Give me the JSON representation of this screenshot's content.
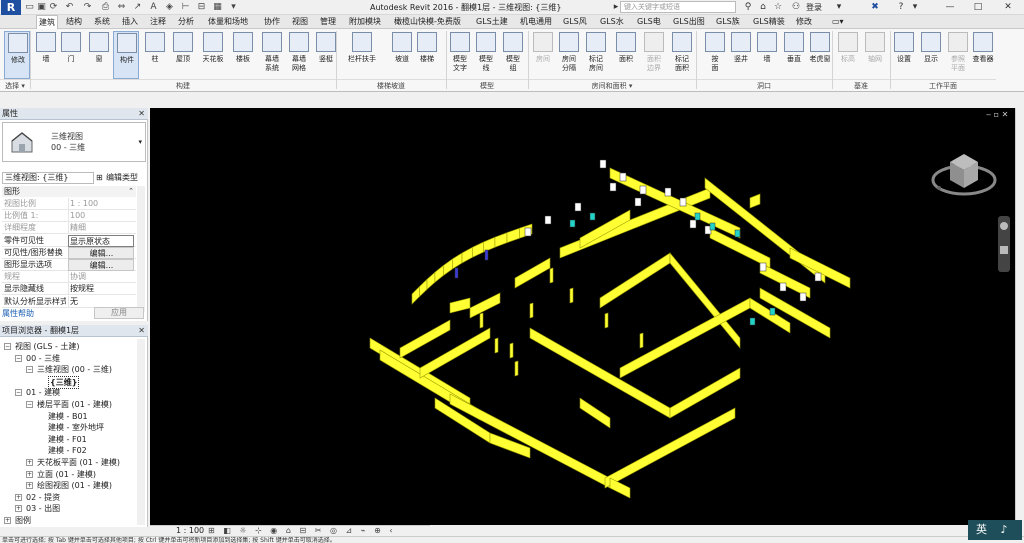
{
  "window": {
    "app_logo": "R",
    "title": "Autodesk Revit 2016 -    翻模1层 - 三维视图: {三维}",
    "search_placeholder": "键入关键字或短语",
    "login": "登录",
    "minimize": "—",
    "maximize": "□",
    "close": "✕"
  },
  "tabs": [
    "建筑",
    "结构",
    "系统",
    "插入",
    "注释",
    "分析",
    "体量和场地",
    "协作",
    "视图",
    "管理",
    "附加模块",
    "橄榄山快模-免费版",
    "GLS土建",
    "机电通用",
    "GLS风",
    "GLS水",
    "GLS电",
    "GLS出图",
    "GLS族",
    "GLS精装",
    "修改"
  ],
  "active_tab_index": 0,
  "ribbon": {
    "panels": [
      {
        "label": "选择 ▾"
      },
      {
        "label": "构建"
      },
      {
        "label": "楼梯坡道"
      },
      {
        "label": "模型"
      },
      {
        "label": "房间和面积 ▾"
      },
      {
        "label": "洞口"
      },
      {
        "label": "基准"
      },
      {
        "label": "工作平面"
      }
    ],
    "buttons": [
      {
        "label": "修改",
        "icon": "cursor-icon",
        "state": "selected"
      },
      {
        "label": "墙",
        "icon": "wall-icon"
      },
      {
        "label": "门",
        "icon": "door-icon"
      },
      {
        "label": "窗",
        "icon": "window-icon"
      },
      {
        "label": "构件",
        "icon": "component-icon",
        "state": "selected"
      },
      {
        "label": "柱",
        "icon": "column-icon"
      },
      {
        "label": "屋顶",
        "icon": "roof-icon"
      },
      {
        "label": "天花板",
        "icon": "ceiling-icon"
      },
      {
        "label": "楼板",
        "icon": "floor-icon"
      },
      {
        "label": "幕墙\n系统",
        "icon": "curtain-system-icon"
      },
      {
        "label": "幕墙\n网格",
        "icon": "curtain-grid-icon"
      },
      {
        "label": "竖梃",
        "icon": "mullion-icon"
      },
      {
        "label": "栏杆扶手",
        "icon": "railing-icon"
      },
      {
        "label": "坡道",
        "icon": "ramp-icon"
      },
      {
        "label": "楼梯",
        "icon": "stair-icon"
      },
      {
        "label": "模型\n文字",
        "icon": "model-text-icon"
      },
      {
        "label": "模型\n线",
        "icon": "model-line-icon"
      },
      {
        "label": "模型\n组",
        "icon": "model-group-icon"
      },
      {
        "label": "房间",
        "icon": "room-icon",
        "state": "disabled"
      },
      {
        "label": "房间\n分隔",
        "icon": "room-separator-icon"
      },
      {
        "label": "标记\n房间",
        "icon": "tag-room-icon"
      },
      {
        "label": "面积",
        "icon": "area-icon"
      },
      {
        "label": "面积\n边界",
        "icon": "area-boundary-icon",
        "state": "disabled"
      },
      {
        "label": "标记\n面积",
        "icon": "tag-area-icon"
      },
      {
        "label": "按\n面",
        "icon": "by-face-icon"
      },
      {
        "label": "竖井",
        "icon": "shaft-icon"
      },
      {
        "label": "墙",
        "icon": "wall-opening-icon"
      },
      {
        "label": "垂直",
        "icon": "vertical-opening-icon"
      },
      {
        "label": "老虎窗",
        "icon": "dormer-icon"
      },
      {
        "label": "标高",
        "icon": "level-icon",
        "state": "disabled"
      },
      {
        "label": "轴网",
        "icon": "grid-icon",
        "state": "disabled"
      },
      {
        "label": "设置",
        "icon": "set-workplane-icon"
      },
      {
        "label": "显示",
        "icon": "show-workplane-icon"
      },
      {
        "label": "参照\n平面",
        "icon": "ref-plane-icon",
        "state": "disabled"
      },
      {
        "label": "查看器",
        "icon": "viewer-icon"
      }
    ]
  },
  "properties": {
    "header": "属性",
    "type_line1": "三维视图",
    "type_line2": "00 - 三维",
    "view_filter": "三维视图: {三维}",
    "edit_type": "编辑类型",
    "group": "图形",
    "rows": [
      {
        "k": "视图比例",
        "v": "1 : 100",
        "grey": true
      },
      {
        "k": "比例值 1:",
        "v": "100",
        "grey": true
      },
      {
        "k": "详细程度",
        "v": "精细",
        "grey": true
      },
      {
        "k": "零件可见性",
        "v": "显示原状态",
        "boxed": true
      },
      {
        "k": "可见性/图形替换",
        "v": "编辑...",
        "btn": true
      },
      {
        "k": "图形显示选项",
        "v": "编辑...",
        "btn": true
      },
      {
        "k": "规程",
        "v": "协调",
        "grey": true
      },
      {
        "k": "显示隐藏线",
        "v": "按规程"
      },
      {
        "k": "默认分析显示样式",
        "v": "无"
      }
    ],
    "help": "属性帮助",
    "apply": "应用"
  },
  "browser": {
    "header": "项目浏览器 - 翻模1层",
    "items": [
      {
        "text": "视图 (GLS - 土建)",
        "depth": 0,
        "toggle": "−"
      },
      {
        "text": "00 - 三维",
        "depth": 1,
        "toggle": "−"
      },
      {
        "text": "三维视图 (00 - 三维)",
        "depth": 2,
        "toggle": "−"
      },
      {
        "text": "{三维}",
        "depth": 3,
        "selected": true
      },
      {
        "text": "01 - 建模",
        "depth": 1,
        "toggle": "−"
      },
      {
        "text": "楼层平面 (01 - 建模)",
        "depth": 2,
        "toggle": "−"
      },
      {
        "text": "建模 - B01",
        "depth": 3
      },
      {
        "text": "建模 - 室外地坪",
        "depth": 3
      },
      {
        "text": "建模 - F01",
        "depth": 3
      },
      {
        "text": "建模 - F02",
        "depth": 3
      },
      {
        "text": "天花板平面 (01 - 建模)",
        "depth": 2,
        "toggle": "+"
      },
      {
        "text": "立面 (01 - 建模)",
        "depth": 2,
        "toggle": "+"
      },
      {
        "text": "绘图视图 (01 - 建模)",
        "depth": 2,
        "toggle": "+"
      },
      {
        "text": "02 - 提资",
        "depth": 1,
        "toggle": "+"
      },
      {
        "text": "03 - 出图",
        "depth": 1,
        "toggle": "+"
      },
      {
        "text": "图例",
        "depth": 0,
        "toggle": "+"
      }
    ]
  },
  "viewbar": {
    "scale": "1 : 100"
  },
  "status": "单击可进行选择; 按 Tab 键并单击可选择其他项目; 按 Ctrl 键并单击可将新项目添加到选择集; 按 Shift 键并单击可取消选择。",
  "ime": {
    "label": "英",
    "extra": "♪"
  },
  "colors": {
    "accent": "#1e4fa0",
    "model_wall": "#ffff33",
    "model_glass": "#22d3c8",
    "canvas_bg": "#000000"
  }
}
